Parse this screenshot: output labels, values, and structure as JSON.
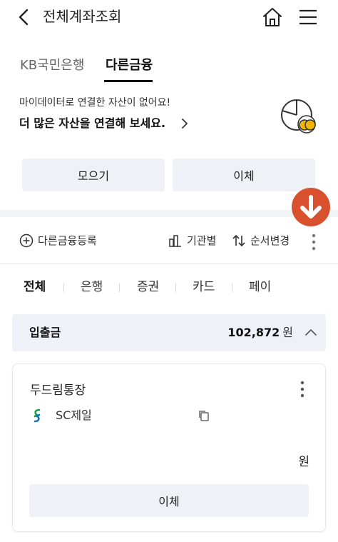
{
  "header": {
    "title": "전체계좌조회",
    "icons": {
      "back": "chevron-left-icon",
      "home": "home-icon",
      "menu": "hamburger-menu-icon"
    }
  },
  "tabs": [
    {
      "label": "KB국민은행",
      "active": false
    },
    {
      "label": "다른금융",
      "active": true
    }
  ],
  "promo": {
    "subtitle": "마이데이터로 연결한 자산이 없어요!",
    "main": "더 많은 자산을 연결해 보세요."
  },
  "actions": {
    "collect_label": "모으기",
    "transfer_label": "이체"
  },
  "toolbar": {
    "register_label": "다른금융등록",
    "institution_label": "기관별",
    "order_label": "순서변경"
  },
  "filters": [
    {
      "label": "전체",
      "active": true
    },
    {
      "label": "은행",
      "active": false
    },
    {
      "label": "증권",
      "active": false
    },
    {
      "label": "카드",
      "active": false
    },
    {
      "label": "페이",
      "active": false
    }
  ],
  "section": {
    "label": "입출금",
    "amount": "102,872",
    "unit": "원"
  },
  "account": {
    "name": "두드림통장",
    "bank": "SC제일",
    "balance_unit": "원",
    "transfer_label": "이체"
  },
  "colors": {
    "accent_fab": "#d9502e",
    "button_bg": "#eef1f5",
    "section_bg": "#eef2f8",
    "coin_gold": "#f2b705"
  }
}
